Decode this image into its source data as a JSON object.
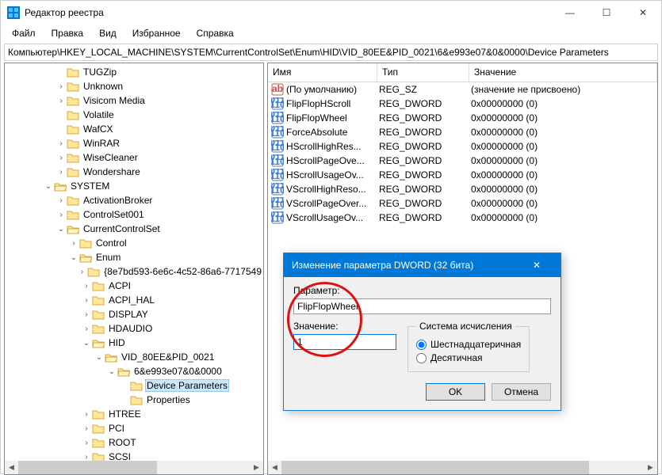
{
  "window": {
    "title": "Редактор реестра",
    "min": "—",
    "max": "☐",
    "close": "✕"
  },
  "menu": [
    "Файл",
    "Правка",
    "Вид",
    "Избранное",
    "Справка"
  ],
  "address": "Компьютер\\HKEY_LOCAL_MACHINE\\SYSTEM\\CurrentControlSet\\Enum\\HID\\VID_80EE&PID_0021\\6&e993e07&0&0000\\Device Parameters",
  "tree": [
    {
      "d": 4,
      "t": "",
      "l": "TUGZip"
    },
    {
      "d": 4,
      "t": ">",
      "l": "Unknown"
    },
    {
      "d": 4,
      "t": ">",
      "l": "Visicom Media"
    },
    {
      "d": 4,
      "t": "",
      "l": "Volatile"
    },
    {
      "d": 4,
      "t": "",
      "l": "WafCX"
    },
    {
      "d": 4,
      "t": ">",
      "l": "WinRAR"
    },
    {
      "d": 4,
      "t": ">",
      "l": "WiseCleaner"
    },
    {
      "d": 4,
      "t": ">",
      "l": "Wondershare"
    },
    {
      "d": 3,
      "t": "v",
      "l": "SYSTEM"
    },
    {
      "d": 4,
      "t": ">",
      "l": "ActivationBroker"
    },
    {
      "d": 4,
      "t": ">",
      "l": "ControlSet001"
    },
    {
      "d": 4,
      "t": "v",
      "l": "CurrentControlSet"
    },
    {
      "d": 5,
      "t": ">",
      "l": "Control"
    },
    {
      "d": 5,
      "t": "v",
      "l": "Enum"
    },
    {
      "d": 6,
      "t": ">",
      "l": "{8e7bd593-6e6c-4c52-86a6-7717549"
    },
    {
      "d": 6,
      "t": ">",
      "l": "ACPI"
    },
    {
      "d": 6,
      "t": ">",
      "l": "ACPI_HAL"
    },
    {
      "d": 6,
      "t": ">",
      "l": "DISPLAY"
    },
    {
      "d": 6,
      "t": ">",
      "l": "HDAUDIO"
    },
    {
      "d": 6,
      "t": "v",
      "l": "HID"
    },
    {
      "d": 7,
      "t": "v",
      "l": "VID_80EE&PID_0021"
    },
    {
      "d": 8,
      "t": "v",
      "l": "6&e993e07&0&0000"
    },
    {
      "d": 9,
      "t": "",
      "l": "Device Parameters",
      "sel": true
    },
    {
      "d": 9,
      "t": "",
      "l": "Properties"
    },
    {
      "d": 6,
      "t": ">",
      "l": "HTREE"
    },
    {
      "d": 6,
      "t": ">",
      "l": "PCI"
    },
    {
      "d": 6,
      "t": ">",
      "l": "ROOT"
    },
    {
      "d": 6,
      "t": ">",
      "l": "SCSI"
    }
  ],
  "list": {
    "headers": {
      "name": "Имя",
      "type": "Тип",
      "value": "Значение"
    },
    "rows": [
      {
        "icon": "sz",
        "name": "(По умолчанию)",
        "type": "REG_SZ",
        "value": "(значение не присвоено)"
      },
      {
        "icon": "dw",
        "name": "FlipFlopHScroll",
        "type": "REG_DWORD",
        "value": "0x00000000 (0)"
      },
      {
        "icon": "dw",
        "name": "FlipFlopWheel",
        "type": "REG_DWORD",
        "value": "0x00000000 (0)"
      },
      {
        "icon": "dw",
        "name": "ForceAbsolute",
        "type": "REG_DWORD",
        "value": "0x00000000 (0)"
      },
      {
        "icon": "dw",
        "name": "HScrollHighRes...",
        "type": "REG_DWORD",
        "value": "0x00000000 (0)"
      },
      {
        "icon": "dw",
        "name": "HScrollPageOve...",
        "type": "REG_DWORD",
        "value": "0x00000000 (0)"
      },
      {
        "icon": "dw",
        "name": "HScrollUsageOv...",
        "type": "REG_DWORD",
        "value": "0x00000000 (0)"
      },
      {
        "icon": "dw",
        "name": "VScrollHighReso...",
        "type": "REG_DWORD",
        "value": "0x00000000 (0)"
      },
      {
        "icon": "dw",
        "name": "VScrollPageOver...",
        "type": "REG_DWORD",
        "value": "0x00000000 (0)"
      },
      {
        "icon": "dw",
        "name": "VScrollUsageOv...",
        "type": "REG_DWORD",
        "value": "0x00000000 (0)"
      }
    ]
  },
  "dialog": {
    "title": "Изменение параметра DWORD (32 бита)",
    "param_label": "Параметр:",
    "param_value": "FlipFlopWheel",
    "value_label": "Значение:",
    "value_input": "1",
    "base_legend": "Система исчисления",
    "radio_hex": "Шестнадцатеричная",
    "radio_dec": "Десятичная",
    "ok": "OK",
    "cancel": "Отмена",
    "close": "✕"
  }
}
